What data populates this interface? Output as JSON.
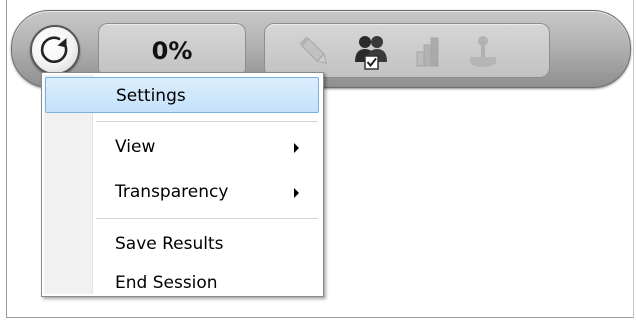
{
  "toolbar": {
    "progress_text": "0%",
    "menu_button_icon": "power-icon",
    "tools": [
      {
        "name": "pencil-icon",
        "enabled": false
      },
      {
        "name": "users-check-icon",
        "enabled": true
      },
      {
        "name": "bar-chart-icon",
        "enabled": false
      },
      {
        "name": "joystick-icon",
        "enabled": false
      }
    ]
  },
  "menu": {
    "items": [
      {
        "label": "Settings",
        "submenu": false,
        "highlighted": true
      },
      {
        "label": "View",
        "submenu": true,
        "highlighted": false
      },
      {
        "label": "Transparency",
        "submenu": true,
        "highlighted": false
      },
      {
        "label": "Save Results",
        "submenu": false,
        "highlighted": false
      },
      {
        "label": "End Session",
        "submenu": false,
        "highlighted": false
      }
    ]
  },
  "colors": {
    "menu_highlight_border": "#7ab1e0",
    "menu_highlight_fill": "#c4e1f9"
  }
}
